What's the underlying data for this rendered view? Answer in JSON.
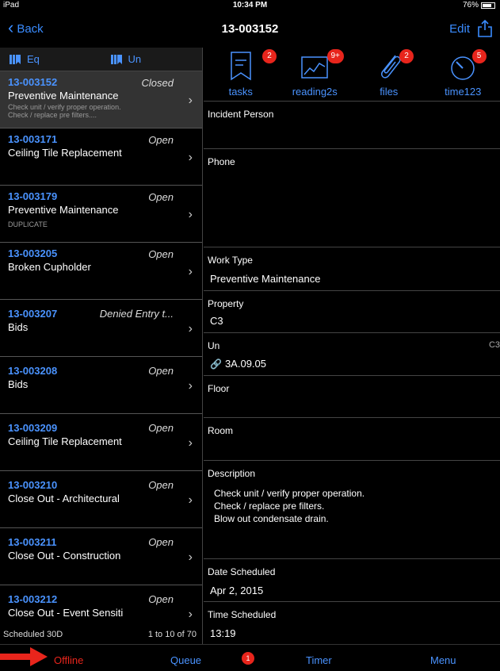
{
  "status": {
    "carrier": "iPad",
    "time": "10:34 PM",
    "battery": "76%"
  },
  "nav": {
    "back": "Back",
    "title": "13-003152",
    "edit": "Edit"
  },
  "segments": [
    {
      "label": "Eq"
    },
    {
      "label": "Un"
    }
  ],
  "work_orders": [
    {
      "number": "13-003152",
      "status": "Closed",
      "title": "Preventive Maintenance",
      "subtitle": "Check unit / verify proper operation.\nCheck / replace pre filters...."
    },
    {
      "number": "13-003171",
      "status": "Open",
      "title": "Ceiling Tile Replacement",
      "subtitle": ""
    },
    {
      "number": "13-003179",
      "status": "Open",
      "title": "Preventive Maintenance",
      "subtitle": "DUPLICATE"
    },
    {
      "number": "13-003205",
      "status": "Open",
      "title": "Broken Cupholder",
      "subtitle": ""
    },
    {
      "number": "13-003207",
      "status": "Denied Entry t...",
      "title": "Bids",
      "subtitle": ""
    },
    {
      "number": "13-003208",
      "status": "Open",
      "title": "Bids",
      "subtitle": ""
    },
    {
      "number": "13-003209",
      "status": "Open",
      "title": "Ceiling Tile Replacement",
      "subtitle": ""
    },
    {
      "number": "13-003210",
      "status": "Open",
      "title": "Close Out - Architectural",
      "subtitle": ""
    },
    {
      "number": "13-003211",
      "status": "Open",
      "title": "Close Out - Construction",
      "subtitle": ""
    },
    {
      "number": "13-003212",
      "status": "Open",
      "title": "Close Out - Event Sensiti",
      "subtitle": ""
    }
  ],
  "list_footer": {
    "filter": "Scheduled 30D",
    "range": "1 to 10 of 70"
  },
  "tabs": [
    {
      "label": "tasks",
      "badge": "2",
      "icon": "bookmark-icon"
    },
    {
      "label": "reading2s",
      "badge": "9+",
      "icon": "chart-icon"
    },
    {
      "label": "files",
      "badge": "2",
      "icon": "paperclip-icon"
    },
    {
      "label": "time123",
      "badge": "5",
      "icon": "timer-icon"
    }
  ],
  "fields": {
    "incident_person": {
      "label": "Incident Person",
      "value": ""
    },
    "phone": {
      "label": "Phone",
      "value": ""
    },
    "work_type": {
      "label": "Work Type",
      "value": "Preventive Maintenance"
    },
    "property": {
      "label": "Property",
      "value": "C3"
    },
    "unit": {
      "label": "Un",
      "value": "3A.09.05",
      "extra": "C3"
    },
    "floor": {
      "label": "Floor",
      "value": ""
    },
    "room": {
      "label": "Room",
      "value": ""
    },
    "description": {
      "label": "Description",
      "value": "Check unit / verify proper operation.\nCheck / replace pre filters.\nBlow out condensate drain."
    },
    "date_scheduled": {
      "label": "Date Scheduled",
      "value": "Apr 2, 2015"
    },
    "time_scheduled": {
      "label": "Time Scheduled",
      "value": "13:19"
    }
  },
  "tab_bar": {
    "offline": "Offline",
    "queue": "Queue",
    "queue_badge": "1",
    "timer": "Timer",
    "menu": "Menu"
  },
  "colors": {
    "accent": "#4a93ff",
    "badge": "#e8251c",
    "offline": "#e8251c"
  }
}
